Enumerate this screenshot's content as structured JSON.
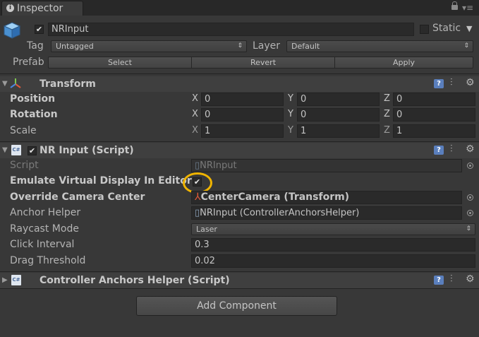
{
  "tab": {
    "label": "Inspector"
  },
  "object": {
    "name": "NRInput",
    "active": true,
    "static_label": "Static",
    "tag_label": "Tag",
    "tag_value": "Untagged",
    "layer_label": "Layer",
    "layer_value": "Default",
    "prefab_label": "Prefab",
    "prefab_select": "Select",
    "prefab_revert": "Revert",
    "prefab_apply": "Apply"
  },
  "transform": {
    "title": "Transform",
    "rows": [
      {
        "label": "Position",
        "x": "0",
        "y": "0",
        "z": "0"
      },
      {
        "label": "Rotation",
        "x": "0",
        "y": "0",
        "z": "0"
      },
      {
        "label": "Scale",
        "x": "1",
        "y": "1",
        "z": "1"
      }
    ],
    "axis_x": "X",
    "axis_y": "Y",
    "axis_z": "Z"
  },
  "nrinput": {
    "title": "NR Input (Script)",
    "script_label": "Script",
    "script_value": "NRInput",
    "emulate_label": "Emulate Virtual Display In Editor",
    "emulate_checked": true,
    "override_label": "Override Camera Center",
    "override_value": "CenterCamera (Transform)",
    "anchor_label": "Anchor Helper",
    "anchor_value": "NRInput (ControllerAnchorsHelper)",
    "raycast_label": "Raycast Mode",
    "raycast_value": "Laser",
    "click_label": "Click Interval",
    "click_value": "0.3",
    "drag_label": "Drag Threshold",
    "drag_value": "0.02"
  },
  "anchors": {
    "title": "Controller Anchors Helper (Script)"
  },
  "add_component": "Add Component",
  "icons": {
    "help": "?",
    "check": "✔",
    "dropdown": "▼",
    "updown": "⇕",
    "cs": "C#"
  },
  "colors": {
    "highlight": "#f0b400",
    "background": "#383838"
  }
}
